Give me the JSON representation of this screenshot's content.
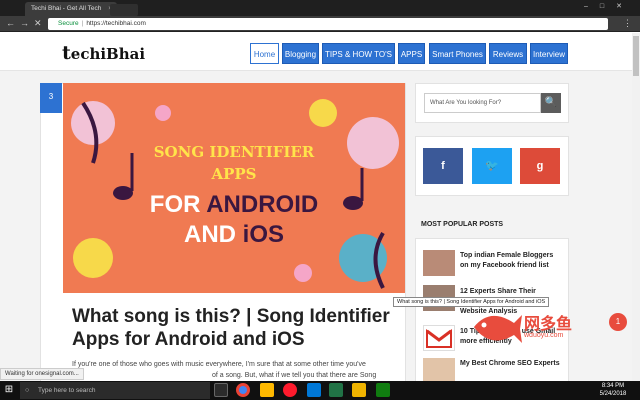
{
  "browser": {
    "tab_title": "Techi Bhai - Get All Tech",
    "tab_close": "×",
    "secure_label": "Secure",
    "url": "https://techibhai.com",
    "stop_label": "✕"
  },
  "site": {
    "logo_t": "t",
    "logo_rest": "echiBhai",
    "menu": [
      "Home",
      "Blogging",
      "TIPS & HOW TO'S",
      "APPS",
      "Smart Phones",
      "Reviews",
      "Interview"
    ]
  },
  "post": {
    "badge": "3",
    "hero": {
      "line1": "SONG IDENTIFIER",
      "line2": "APPS",
      "line3_a": "FOR ",
      "line3_b": "ANDROID",
      "line4_a": "AND ",
      "line4_b": "iOS"
    },
    "title": "What song is this? | Song Identifier Apps for Android and iOS",
    "excerpt_1": "If you're one of those who goes with music everywhere, I'm sure that at some other time you've",
    "excerpt_2": "of a song. But, what if we tell you that there are Song"
  },
  "tooltip": "What song is this? | Song Identifier Apps for Android and iOS",
  "sidebar": {
    "search_placeholder": "What Are You looking For?",
    "search_icon": "🔍",
    "social": [
      {
        "label": "f",
        "color": "#3b5998"
      },
      {
        "label": "🐦",
        "color": "#1da1f2"
      },
      {
        "label": "g",
        "color": "#dd4b39"
      }
    ],
    "popular_heading": "MOST POPULAR POSTS",
    "popular": [
      {
        "title": "Top indian Female Bloggers on my Facebook friend list"
      },
      {
        "title": "12 Experts Share Their"
      },
      {
        "title": "Website Analysis"
      },
      {
        "title": "10 Tips on How to use Gmail more efficiently"
      },
      {
        "title": "My Best Chrome SEO Experts"
      }
    ]
  },
  "status": "Waiting for onesignal.com...",
  "watermark": {
    "zh": "网多鱼",
    "en": "wduoyu.com",
    "notif": "1"
  },
  "taskbar": {
    "start_icon": "⊞",
    "search_placeholder": "Type here to search",
    "time": "8:34 PM",
    "date": "5/24/2018"
  }
}
